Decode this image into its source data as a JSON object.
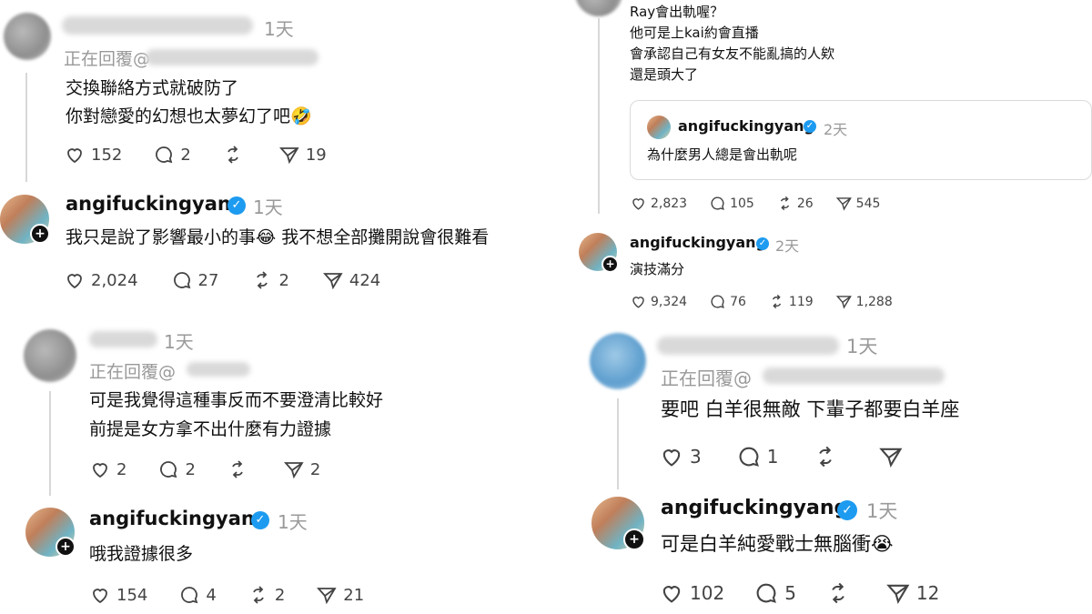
{
  "left": {
    "c1": {
      "time": "1天",
      "replying": "正在回覆@",
      "line1": "交換聯絡方式就破防了",
      "line2": "你對戀愛的幻想也太夢幻了吧🤣",
      "likes": "152",
      "comments": "2",
      "reposts": "",
      "shares": "19"
    },
    "c2": {
      "user": "angifuckingyang",
      "time": "1天",
      "text": "我只是說了影響最小的事😂 我不想全部攤開說會很難看",
      "likes": "2,024",
      "comments": "27",
      "reposts": "2",
      "shares": "424"
    },
    "c3": {
      "time": "1天",
      "replying": "正在回覆@",
      "line1": "可是我覺得這種事反而不要澄清比較好",
      "line2": "前提是女方拿不出什麼有力證據",
      "likes": "2",
      "comments": "2",
      "reposts": "",
      "shares": "2"
    },
    "c4": {
      "user": "angifuckingyang",
      "time": "1天",
      "text": "哦我證據很多",
      "likes": "154",
      "comments": "4",
      "reposts": "2",
      "shares": "21"
    }
  },
  "right": {
    "c1": {
      "lines": [
        "Ray會出軌喔？",
        "他可是上kai約會直播",
        "會承認自己有女友不能亂搞的人欸",
        "還是頭大了"
      ],
      "quote": {
        "user": "angifuckingyang",
        "time": "2天",
        "text": "為什麼男人總是會出軌呢"
      },
      "likes": "2,823",
      "comments": "105",
      "reposts": "26",
      "shares": "545"
    },
    "c2": {
      "user": "angifuckingyang",
      "time": "2天",
      "text": "演技滿分",
      "likes": "9,324",
      "comments": "76",
      "reposts": "119",
      "shares": "1,288"
    },
    "c3": {
      "time": "1天",
      "replying": "正在回覆@",
      "text": "要吧 白羊很無敵 下輩子都要白羊座",
      "likes": "3",
      "comments": "1",
      "reposts": "",
      "shares": ""
    },
    "c4": {
      "user": "angifuckingyang",
      "time": "1天",
      "text": "可是白羊純愛戰士無腦衝😭",
      "likes": "102",
      "comments": "5",
      "reposts": "",
      "shares": "12"
    }
  },
  "icons": {
    "verified": "✓",
    "plus": "+"
  }
}
